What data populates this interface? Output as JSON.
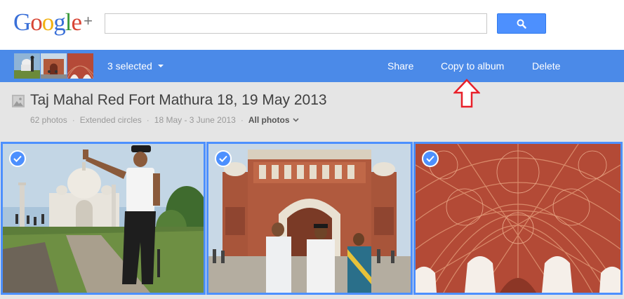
{
  "header": {
    "logo_letters": [
      {
        "ch": "G",
        "color": "#3a70d8"
      },
      {
        "ch": "o",
        "color": "#d84535"
      },
      {
        "ch": "o",
        "color": "#f2b10f"
      },
      {
        "ch": "g",
        "color": "#3a70d8"
      },
      {
        "ch": "l",
        "color": "#3a9a3c"
      },
      {
        "ch": "e",
        "color": "#d84535"
      }
    ],
    "logo_plus": "+",
    "search_value": "",
    "search_icon": "magnifier-icon"
  },
  "actionbar": {
    "selected_label": "3 selected",
    "share_label": "Share",
    "copy_label": "Copy to album",
    "delete_label": "Delete"
  },
  "album": {
    "title": "Taj Mahal Red Fort Mathura 18, 19 May 2013",
    "photo_count": "62 photos",
    "visibility": "Extended circles",
    "date_range": "18 May - 3 June 2013",
    "filter_label": "All photos"
  },
  "photos": [
    {
      "name": "taj-mahal",
      "selected": true
    },
    {
      "name": "red-fort-gate",
      "selected": true
    },
    {
      "name": "red-ceiling",
      "selected": true
    }
  ],
  "colors": {
    "accent": "#4b8ae8",
    "selection": "#4d90fe",
    "annotation": "#e8202a"
  }
}
